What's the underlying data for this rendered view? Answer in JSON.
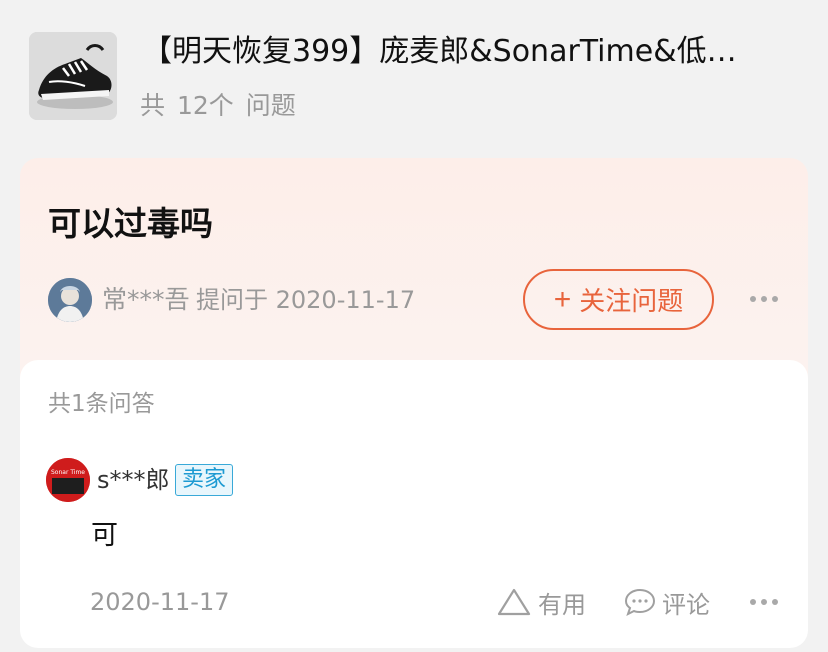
{
  "product": {
    "title": "【明天恢复399】庞麦郎&SonarTime&低…",
    "question_count": "共 12个 问题"
  },
  "question": {
    "title": "可以过毒吗",
    "asker_name": "常***吾",
    "asked_meta": "提问于 2020-11-17",
    "follow_label": "关注问题"
  },
  "answers": {
    "count_label": "共1条问答",
    "items": [
      {
        "user_name": "s***郎",
        "badge": "卖家",
        "avatar_text": "Sonar Time",
        "text": "可",
        "date": "2020-11-17",
        "useful_label": "有用",
        "comment_label": "评论"
      }
    ]
  },
  "colors": {
    "accent": "#e8643c",
    "seller_badge": "#1d9ad2",
    "card_tint": "#fdeee9"
  }
}
